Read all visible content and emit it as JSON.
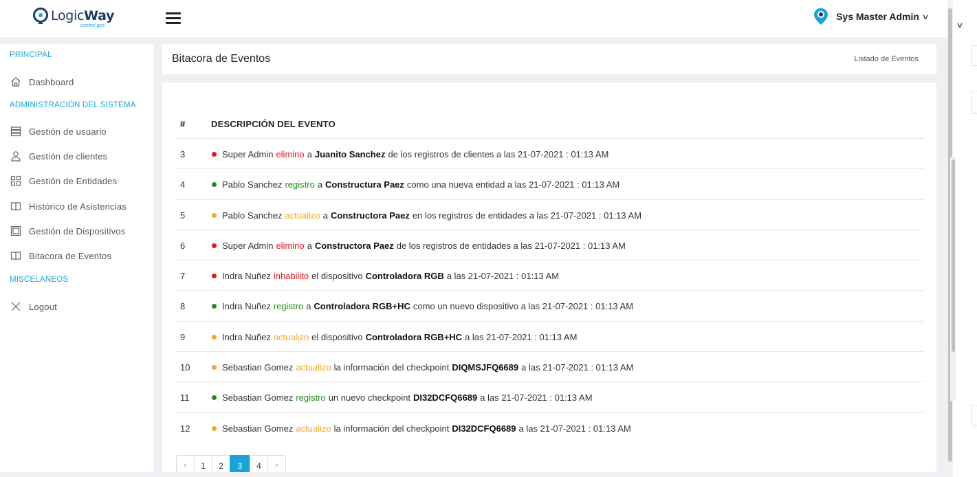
{
  "app": {
    "logo_main": "Logic",
    "logo_bold": "Way",
    "logo_sub": "control gps",
    "user_name": "Sys Master Admin"
  },
  "sidebar": {
    "sections": [
      {
        "label": "PRINCIPAL"
      },
      {
        "label": "ADMINISTRACIÓN DEL SISTEMA"
      },
      {
        "label": "MISCELANEOS"
      }
    ],
    "items": [
      {
        "label": "Dashboard",
        "icon": "home-icon"
      },
      {
        "label": "Gestión de usuario",
        "icon": "server-icon"
      },
      {
        "label": "Gestión de clientes",
        "icon": "user-icon"
      },
      {
        "label": "Gestión de Entidades",
        "icon": "grid-icon"
      },
      {
        "label": "Histórico de Asistencias",
        "icon": "book-icon"
      },
      {
        "label": "Gestión de Dispositivos",
        "icon": "device-icon"
      },
      {
        "label": "Bitacora de Eventos",
        "icon": "book-icon"
      },
      {
        "label": "Logout",
        "icon": "close-icon"
      }
    ]
  },
  "page": {
    "title": "Bitacora de Eventos",
    "breadcrumb": "Listado de Eventos"
  },
  "table": {
    "headers": [
      "#",
      "DESCRIPCIÓN DEL EVENTO"
    ],
    "colors": {
      "red": "#e8161b",
      "green": "#1a8f1a",
      "orange": "#f5a623"
    },
    "rows": [
      {
        "num": "3",
        "status": "red",
        "actor": "Super Admin",
        "verb": "elimino",
        "pre": "a",
        "target": "Juanito Sanchez",
        "rest": "de los registros de clientes a las 21-07-2021 : 01:13 AM"
      },
      {
        "num": "4",
        "status": "green",
        "actor": "Pablo Sanchez",
        "verb": "registro",
        "pre": "a",
        "target": "Constructura Paez",
        "rest": "como una nueva entidad a las 21-07-2021 : 01:13 AM"
      },
      {
        "num": "5",
        "status": "orange",
        "actor": "Pablo Sanchez",
        "verb": "actualizo",
        "pre": "a",
        "target": "Constructora Paez",
        "rest": "en los registros de entidades a las 21-07-2021 : 01:13 AM"
      },
      {
        "num": "6",
        "status": "red",
        "actor": "Super Admin",
        "verb": "elimino",
        "pre": "a",
        "target": "Constructora Paez",
        "rest": "de los registros de entidades a las 21-07-2021 : 01:13 AM"
      },
      {
        "num": "7",
        "status": "red",
        "actor": "Indra Nuñez",
        "verb": "inhabilito",
        "pre": "el dispositivo",
        "target": "Controladora RGB",
        "rest": "a las 21-07-2021 : 01:13 AM"
      },
      {
        "num": "8",
        "status": "green",
        "actor": "Indra Nuñez",
        "verb": "registro",
        "pre": "a",
        "target": "Controladora RGB+HC",
        "rest": "como un nuevo dispositivo a las 21-07-2021 : 01:13 AM"
      },
      {
        "num": "9",
        "status": "orange",
        "actor": "Indra Nuñez",
        "verb": "actualizo",
        "pre": "el dispositivo",
        "target": "Controladora RGB+HC",
        "rest": "a las 21-07-2021 : 01:13 AM"
      },
      {
        "num": "10",
        "status": "orange",
        "actor": "Sebastian Gomez",
        "verb": "actualizo",
        "pre": "la información del checkpoint",
        "target": "DIQMSJFQ6689",
        "rest": "a las 21-07-2021 : 01:13 AM"
      },
      {
        "num": "11",
        "status": "green",
        "actor": "Sebastian Gomez",
        "verb": "registro",
        "pre": "un nuevo checkpoint",
        "target": "DI32DCFQ6689",
        "rest": "a las 21-07-2021 : 01:13 AM"
      },
      {
        "num": "12",
        "status": "orange",
        "actor": "Sebastian Gomez",
        "verb": "actualizo",
        "pre": "la información del checkpoint",
        "target": "DI32DCFQ6689",
        "rest": "a las 21-07-2021 : 01:13 AM"
      }
    ]
  },
  "pagination": {
    "prev": "‹",
    "next": "›",
    "pages": [
      "1",
      "2",
      "3",
      "4"
    ],
    "current": "3"
  },
  "accent": "#1aa3d9"
}
